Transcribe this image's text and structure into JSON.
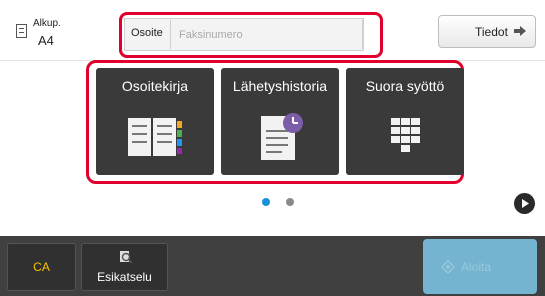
{
  "top": {
    "original_label": "Alkup.",
    "original_size": "A4",
    "address_label": "Osoite",
    "address_placeholder": "Faksinumero",
    "details_label": "Tiedot"
  },
  "tiles": [
    {
      "label": "Osoitekirja",
      "icon": "address-book-icon"
    },
    {
      "label": "Lähetyshistoria",
      "icon": "send-history-icon"
    },
    {
      "label": "Suora syöttö",
      "icon": "keypad-icon"
    }
  ],
  "pager": {
    "page_count": 2,
    "current_page": 1
  },
  "bottom": {
    "ca_label": "CA",
    "preview_label": "Esikatselu",
    "start_label": "Aloita"
  },
  "colors": {
    "highlight": "#e0002b",
    "tile_bg": "#3a3a3a",
    "ca_text": "#f5c400",
    "start_bg": "#7fc9ea",
    "dot_active": "#1a8fd6",
    "dot_inactive": "#8a8a8a"
  }
}
